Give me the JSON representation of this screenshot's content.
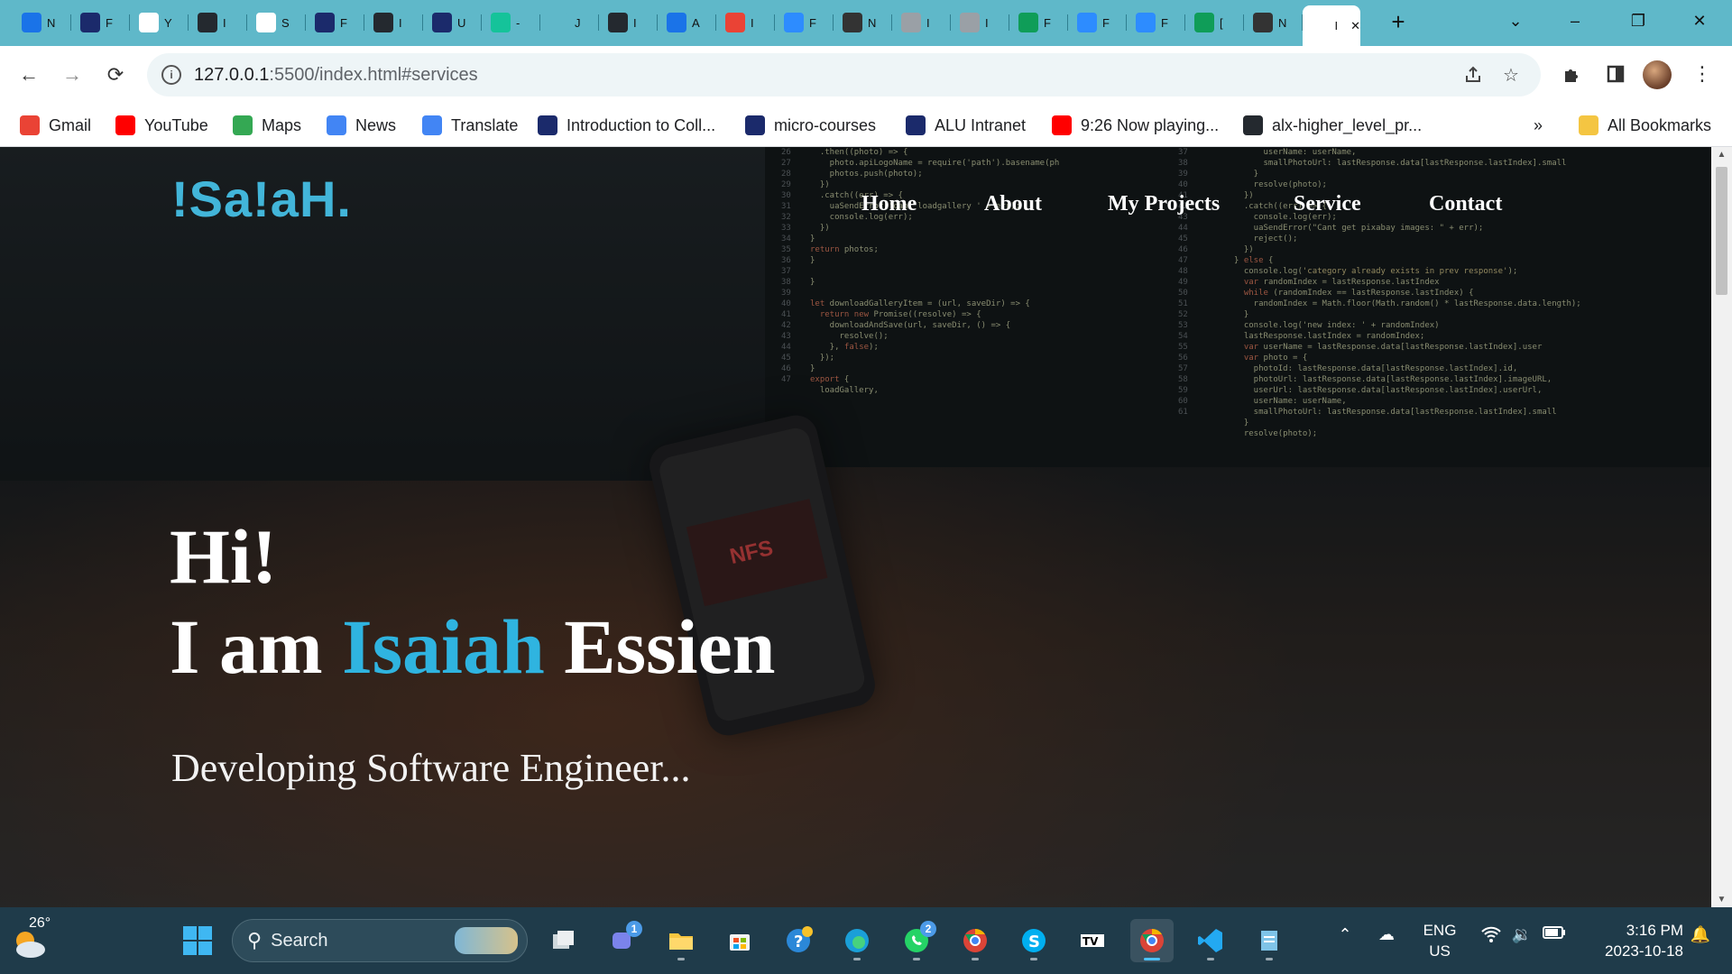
{
  "browser": {
    "tabs": [
      {
        "label": "N",
        "icon": "news-favicon",
        "color": "#1a73e8"
      },
      {
        "label": "F",
        "icon": "alu-favicon",
        "color": "#1b2a6b"
      },
      {
        "label": "Y",
        "icon": "google-favicon",
        "color": "#ffffff"
      },
      {
        "label": "I",
        "icon": "github-favicon",
        "color": "#24292f"
      },
      {
        "label": "S",
        "icon": "google-favicon",
        "color": "#ffffff"
      },
      {
        "label": "F",
        "icon": "alu-favicon",
        "color": "#1b2a6b"
      },
      {
        "label": "I",
        "icon": "github-favicon",
        "color": "#24292f"
      },
      {
        "label": "U",
        "icon": "alu-favicon",
        "color": "#1b2a6b"
      },
      {
        "label": "-",
        "icon": "grammarly-favicon",
        "color": "#15c39a"
      },
      {
        "label": "J",
        "icon": "blank-favicon",
        "color": "#5fb8c9"
      },
      {
        "label": "I",
        "icon": "github-favicon",
        "color": "#24292f"
      },
      {
        "label": "A",
        "icon": "calendar-favicon",
        "color": "#1a73e8"
      },
      {
        "label": "I",
        "icon": "gmail-favicon",
        "color": "#ea4335"
      },
      {
        "label": "F",
        "icon": "zoom-favicon",
        "color": "#2d8cff"
      },
      {
        "label": "N",
        "icon": "openai-favicon",
        "color": "#333333"
      },
      {
        "label": "I",
        "icon": "openai-favicon",
        "color": "#9aa0a6"
      },
      {
        "label": "I",
        "icon": "openai-favicon",
        "color": "#9aa0a6"
      },
      {
        "label": "F",
        "icon": "sheets-favicon",
        "color": "#0f9d58"
      },
      {
        "label": "F",
        "icon": "zoom-favicon",
        "color": "#2d8cff"
      },
      {
        "label": "F",
        "icon": "zoom-favicon",
        "color": "#2d8cff"
      },
      {
        "label": "[",
        "icon": "gemini-favicon",
        "color": "#0f9d58"
      },
      {
        "label": "N",
        "icon": "openai-favicon",
        "color": "#333333"
      },
      {
        "label": "I",
        "icon": "page-favicon",
        "color": "#ffffff"
      }
    ],
    "url_host": "127.0.0.1",
    "url_path": ":5500/index.html#services",
    "bookmarks": [
      {
        "label": "Gmail",
        "icon": "gmail-icon",
        "color": "#ea4335"
      },
      {
        "label": "YouTube",
        "icon": "youtube-icon",
        "color": "#ff0000"
      },
      {
        "label": "Maps",
        "icon": "maps-icon",
        "color": "#34a853"
      },
      {
        "label": "News",
        "icon": "news-icon",
        "color": "#4285f4"
      },
      {
        "label": "Translate",
        "icon": "translate-icon",
        "color": "#4285f4"
      },
      {
        "label": "Introduction to Coll...",
        "icon": "alu-icon",
        "color": "#1b2a6b"
      },
      {
        "label": "micro-courses",
        "icon": "alu-icon",
        "color": "#1b2a6b"
      },
      {
        "label": "ALU Intranet",
        "icon": "alu-icon",
        "color": "#1b2a6b"
      },
      {
        "label": "9:26 Now playing...",
        "icon": "youtube-icon",
        "color": "#ff0000"
      },
      {
        "label": "alx-higher_level_pr...",
        "icon": "github-icon",
        "color": "#24292f"
      }
    ],
    "all_bookmarks": "All Bookmarks",
    "overflow": "»"
  },
  "site": {
    "brand": "!Sa!aH.",
    "nav": [
      "Home",
      "About",
      "My Projects",
      "Service",
      "Contact"
    ],
    "hero_hi": "Hi!",
    "hero_prefix": "I am",
    "hero_first": "Isaiah",
    "hero_last": "Essien",
    "hero_sub": "Developing Software Engineer...",
    "accent_color": "#2fb4e0"
  },
  "taskbar": {
    "weather_temp": "26°",
    "search_placeholder": "Search",
    "teams_badge": "1",
    "whatsapp_badge": "2",
    "lang_top": "ENG",
    "lang_bottom": "US",
    "time": "3:16 PM",
    "date": "2023-10-18"
  }
}
